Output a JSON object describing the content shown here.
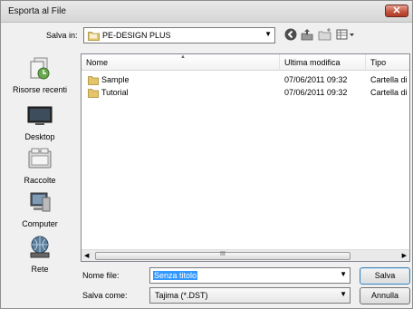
{
  "window": {
    "title": "Esporta al File",
    "close_glyph": "✕"
  },
  "toolbar": {
    "save_in_label": "Salva in:",
    "current_folder": "PE-DESIGN PLUS",
    "icons": [
      "back-icon",
      "up-folder-icon",
      "new-folder-icon",
      "view-menu-icon"
    ]
  },
  "places": [
    {
      "label": "Risorse recenti",
      "icon": "recent-icon"
    },
    {
      "label": "Desktop",
      "icon": "desktop-icon"
    },
    {
      "label": "Raccolte",
      "icon": "libraries-icon"
    },
    {
      "label": "Computer",
      "icon": "computer-icon"
    },
    {
      "label": "Rete",
      "icon": "network-icon"
    }
  ],
  "filelist": {
    "columns": {
      "name": "Nome",
      "modified": "Ultima modifica",
      "type": "Tipo"
    },
    "rows": [
      {
        "name": "Sample",
        "modified": "07/06/2011 09:32",
        "type": "Cartella di file"
      },
      {
        "name": "Tutorial",
        "modified": "07/06/2011 09:32",
        "type": "Cartella di file"
      }
    ],
    "scroll_grip": "III"
  },
  "form": {
    "file_name_label": "Nome file:",
    "file_name_value": "Senza titolo",
    "save_as_label": "Salva come:",
    "save_as_value": "Tajima (*.DST)",
    "save_button": "Salva",
    "cancel_button": "Annulla"
  },
  "colors": {
    "selection": "#3399ff",
    "close_button": "#c0533e",
    "default_button_border": "#3c7fb1"
  }
}
